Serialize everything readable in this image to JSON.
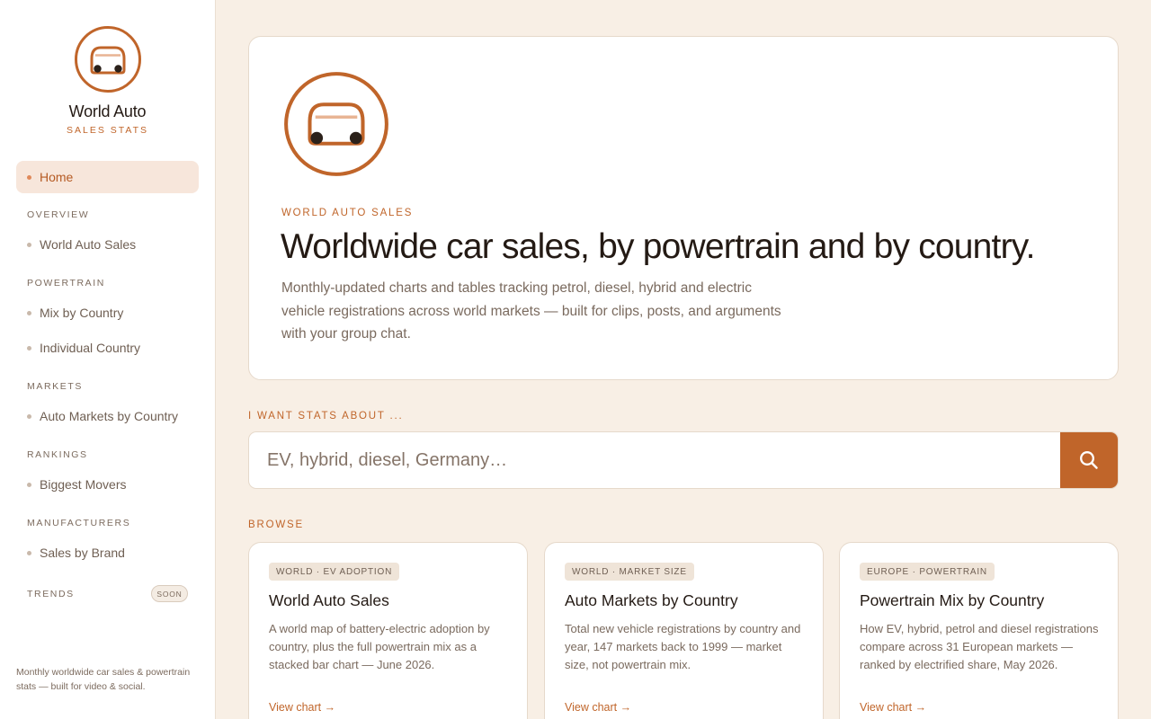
{
  "brand": {
    "name": "World Auto",
    "subtitle": "SALES STATS"
  },
  "sidebar": {
    "home_label": "Home",
    "sections": [
      {
        "label": "OVERVIEW",
        "items": [
          "World Auto Sales"
        ]
      },
      {
        "label": "POWERTRAIN",
        "items": [
          "Mix by Country",
          "Individual Country"
        ]
      },
      {
        "label": "MARKETS",
        "items": [
          "Auto Markets by Country"
        ]
      },
      {
        "label": "RANKINGS",
        "items": [
          "Biggest Movers"
        ]
      },
      {
        "label": "MANUFACTURERS",
        "items": [
          "Sales by Brand"
        ]
      }
    ],
    "trends_label": "TRENDS",
    "soon_badge": "SOON",
    "footer": "Monthly worldwide car sales & powertrain stats — built for video & social."
  },
  "hero": {
    "eyebrow": "WORLD AUTO SALES",
    "title": "Worldwide car sales, by powertrain and by country.",
    "description": "Monthly-updated charts and tables tracking petrol, diesel, hybrid and electric vehicle registrations across world markets — built for clips, posts, and arguments with your group chat."
  },
  "search": {
    "label": "I WANT STATS ABOUT ...",
    "placeholder": "EV, hybrid, diesel, Germany…",
    "value": ""
  },
  "browse": {
    "label": "BROWSE",
    "cards": [
      {
        "tag": "WORLD · EV ADOPTION",
        "title": "World Auto Sales",
        "description": "A world map of battery-electric adoption by country, plus the full powertrain mix as a stacked bar chart — June 2026.",
        "link": "View chart →"
      },
      {
        "tag": "WORLD · MARKET SIZE",
        "title": "Auto Markets by Country",
        "description": "Total new vehicle registrations by country and year, 147 markets back to 1999 — market size, not powertrain mix.",
        "link": "View chart →"
      },
      {
        "tag": "EUROPE · POWERTRAIN",
        "title": "Powertrain Mix by Country",
        "description": "How EV, hybrid, petrol and diesel registrations compare across 31 European markets — ranked by electrified share, May 2026.",
        "link": "View chart →"
      }
    ]
  },
  "colors": {
    "accent": "#c0652a",
    "background": "#f8efe5",
    "surface": "#ffffff",
    "home_highlight": "#f7e6db",
    "text_dark": "#241a14",
    "text_muted": "#7a6a5e"
  },
  "icons": {
    "brand_logo": "car-logo-icon",
    "search_button": "search-icon"
  }
}
